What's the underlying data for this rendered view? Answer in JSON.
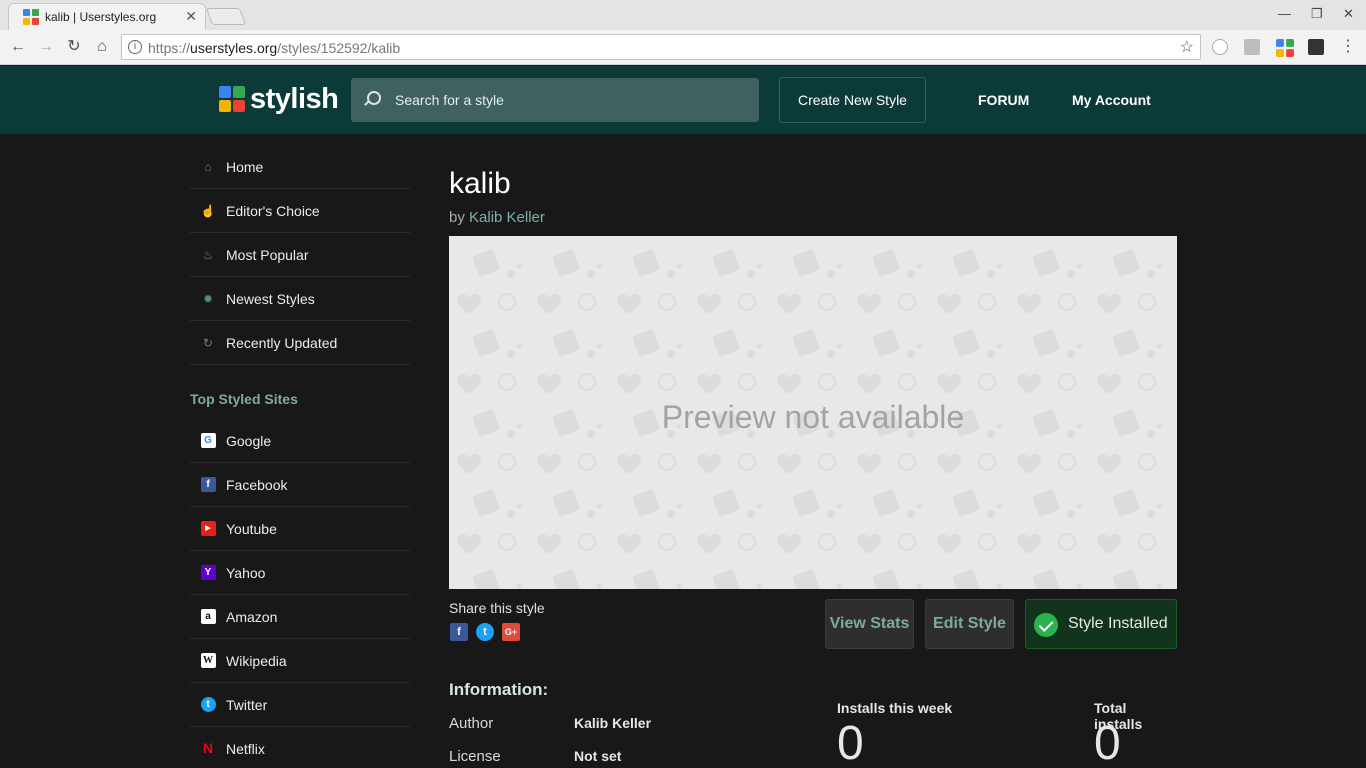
{
  "browser": {
    "tab_title": "kalib | Userstyles.org",
    "tab_close": "✕",
    "url_scheme": "https://",
    "url_host": "userstyles.org",
    "url_path": "/styles/152592/kalib",
    "info_glyph": "i"
  },
  "header": {
    "logo_text": "stylish",
    "search_placeholder": "Search for a style",
    "create_label": "Create New Style",
    "forum_label": "FORUM",
    "account_label": "My Account",
    "brand_color": "#0c3a38"
  },
  "sidebar": {
    "nav": [
      {
        "label": "Home",
        "icon": "home-icon"
      },
      {
        "label": "Editor's Choice",
        "icon": "hand-pointer-icon"
      },
      {
        "label": "Most Popular",
        "icon": "flame-icon"
      },
      {
        "label": "Newest Styles",
        "icon": "star-burst-icon"
      },
      {
        "label": "Recently Updated",
        "icon": "refresh-icon"
      }
    ],
    "sites_heading": "Top Styled Sites",
    "sites": [
      {
        "label": "Google",
        "icon": "google-icon",
        "glyph": "G",
        "color": "#ffffff"
      },
      {
        "label": "Facebook",
        "icon": "facebook-icon",
        "glyph": "f",
        "color": "#3b5998"
      },
      {
        "label": "Youtube",
        "icon": "youtube-icon",
        "glyph": "▶",
        "color": "#e62117"
      },
      {
        "label": "Yahoo",
        "icon": "yahoo-icon",
        "glyph": "Y",
        "color": "#5f01d1"
      },
      {
        "label": "Amazon",
        "icon": "amazon-icon",
        "glyph": "a",
        "color": "#ffffff"
      },
      {
        "label": "Wikipedia",
        "icon": "wikipedia-icon",
        "glyph": "W",
        "color": "#ffffff"
      },
      {
        "label": "Twitter",
        "icon": "twitter-icon",
        "glyph": "t",
        "color": "#1da1f2"
      },
      {
        "label": "Netflix",
        "icon": "netflix-icon",
        "glyph": "N",
        "color": "#181818"
      }
    ]
  },
  "style": {
    "title": "kalib",
    "by_prefix": "by",
    "author": "Kalib Keller",
    "preview_text": "Preview not available"
  },
  "share": {
    "label": "Share this style",
    "facebook_glyph": "f",
    "twitter_glyph": "t",
    "gplus_glyph": "G+"
  },
  "actions": {
    "view_stats": "View Stats",
    "edit_style": "Edit Style",
    "installed": "Style Installed"
  },
  "information": {
    "heading": "Information:",
    "author_key": "Author",
    "author_value": "Kalib Keller",
    "license_key": "License",
    "license_value": "Not set"
  },
  "stats": {
    "week_label": "Installs this week",
    "week_value": "0",
    "total_label": "Total installs",
    "total_value": "0"
  }
}
